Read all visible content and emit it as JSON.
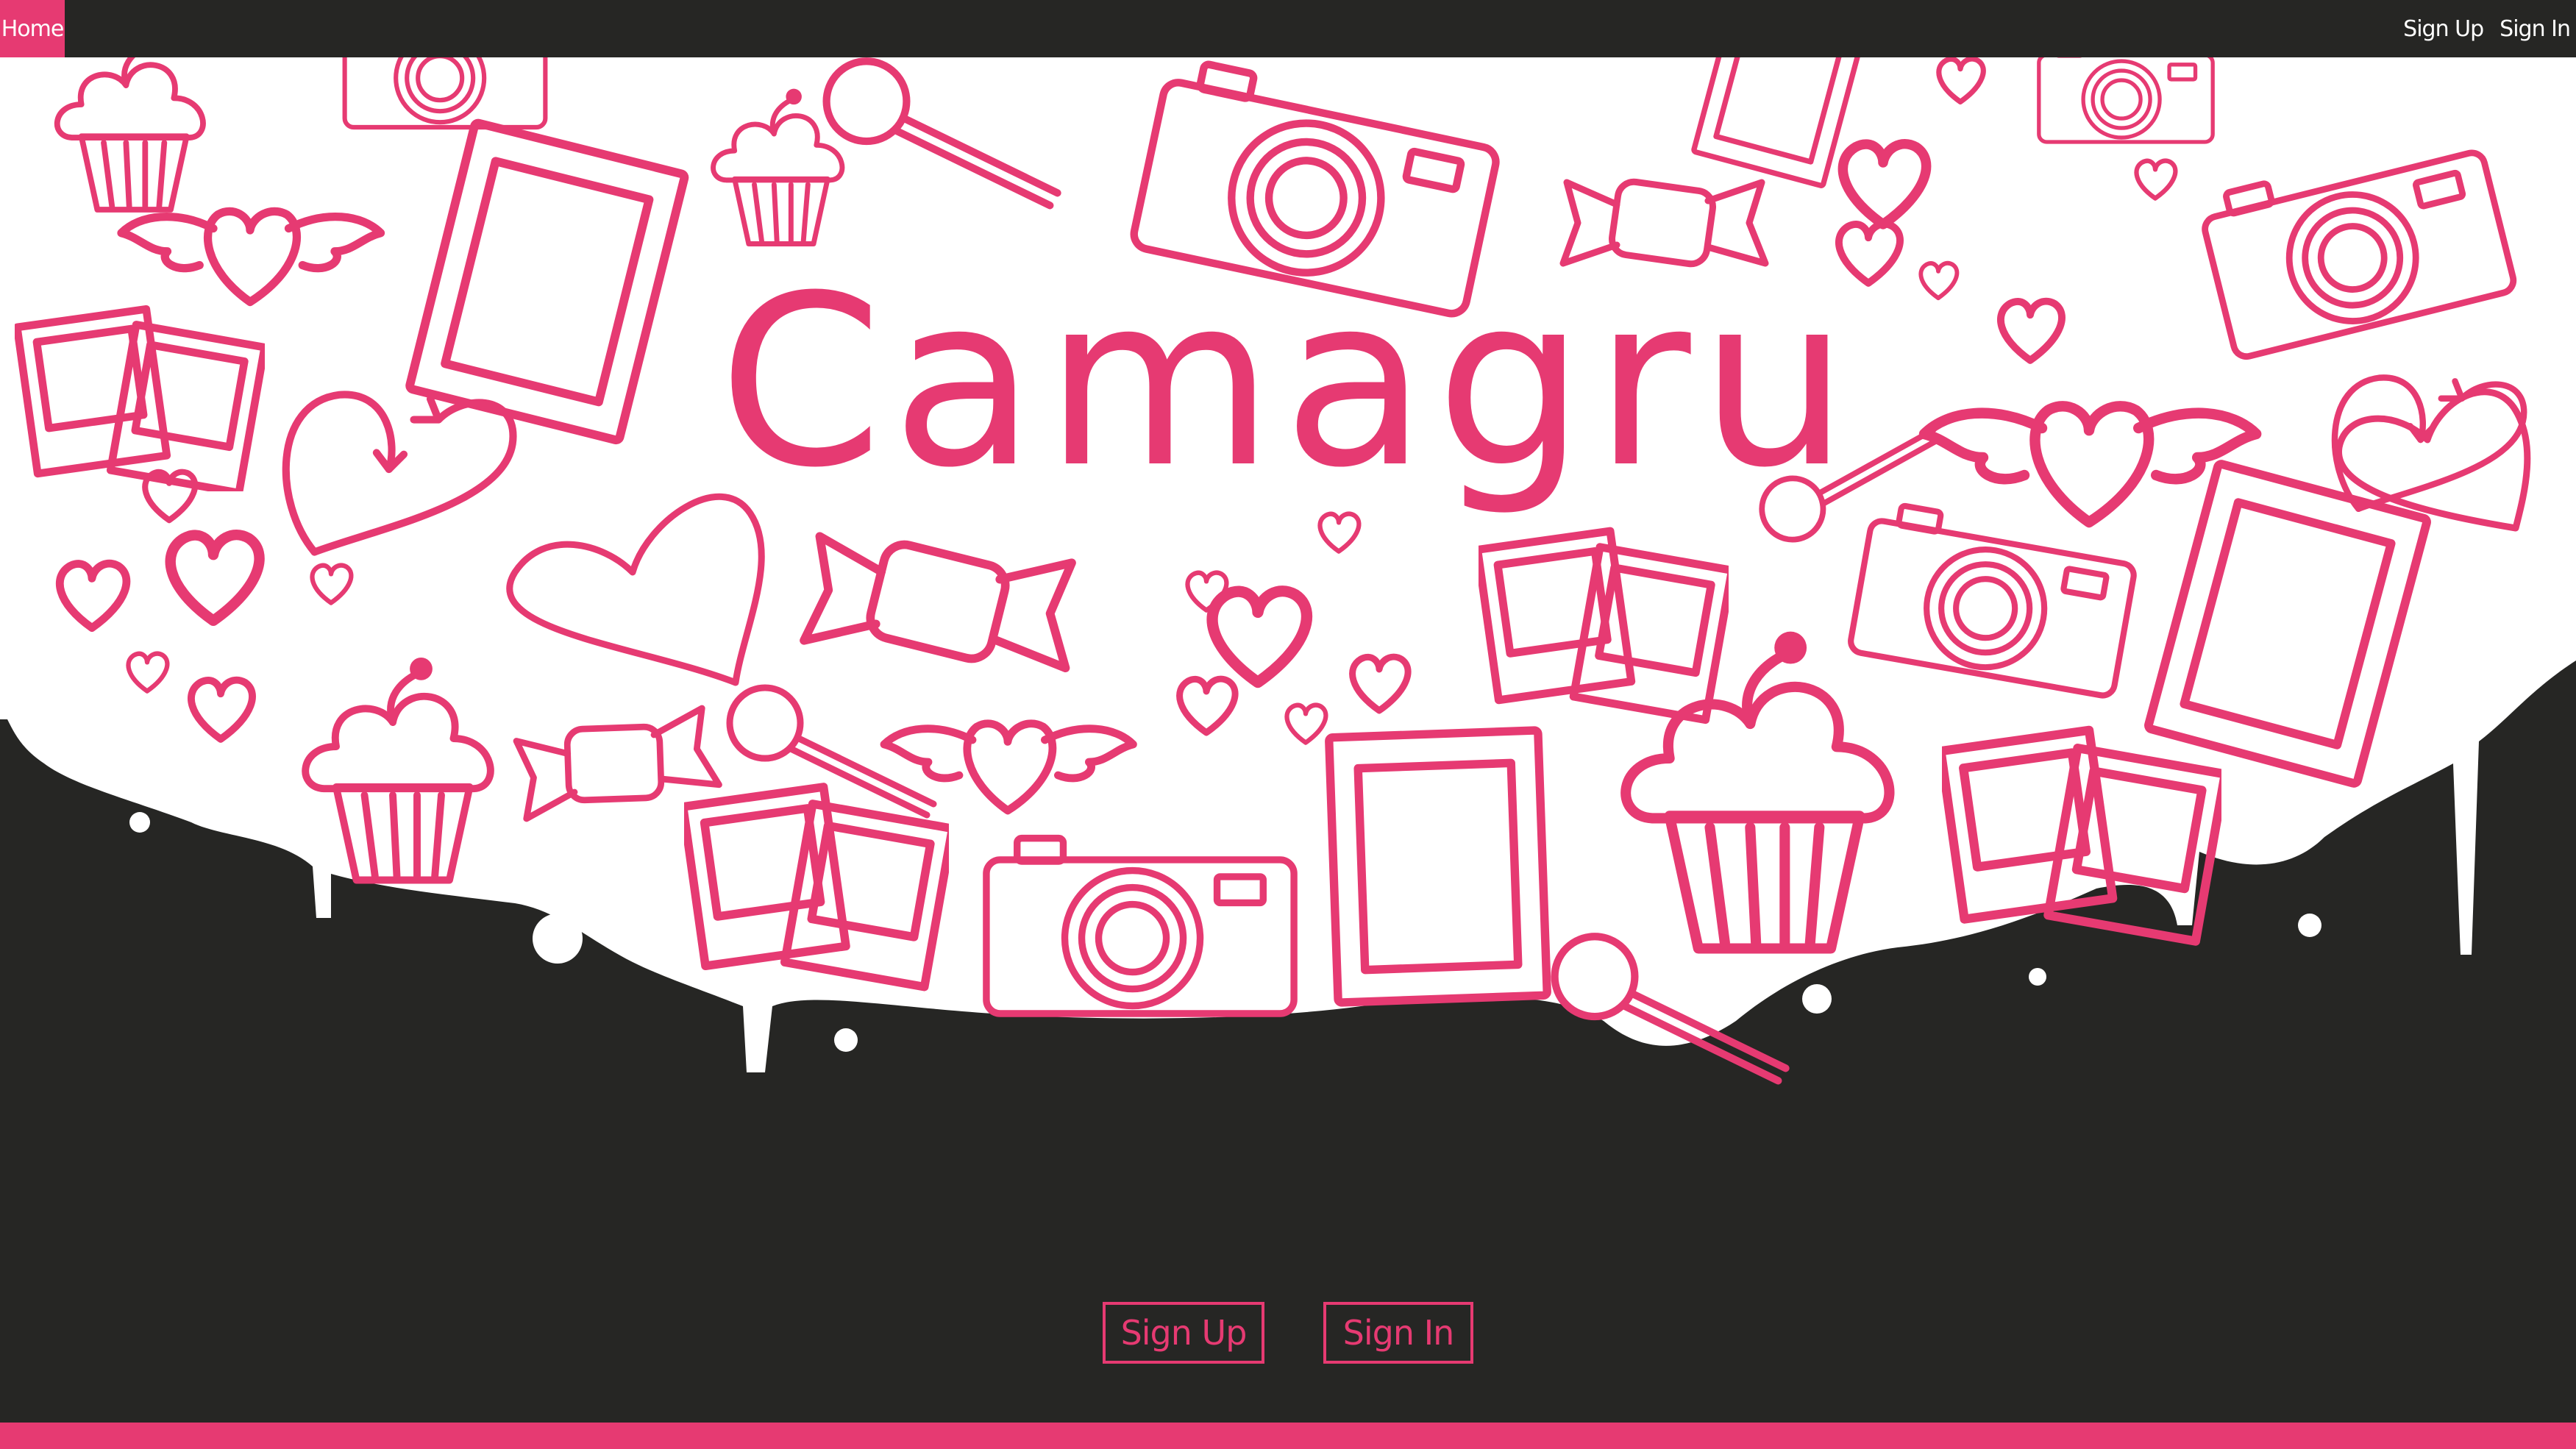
{
  "nav": {
    "home_label": "Home",
    "signup_label": "Sign Up",
    "signin_label": "Sign In"
  },
  "hero": {
    "title": "Camagru"
  },
  "cta": {
    "signup_label": "Sign Up",
    "signin_label": "Sign In"
  },
  "colors": {
    "accent": "#e63a72",
    "background": "#262624",
    "hero_bg": "#ffffff"
  },
  "icons": [
    "camera-icon",
    "cupcake-icon",
    "heart-icon",
    "winged-heart-icon",
    "candy-icon",
    "lollipop-icon",
    "photo-frame-icon",
    "polaroid-icon",
    "arrow-heart-icon"
  ]
}
